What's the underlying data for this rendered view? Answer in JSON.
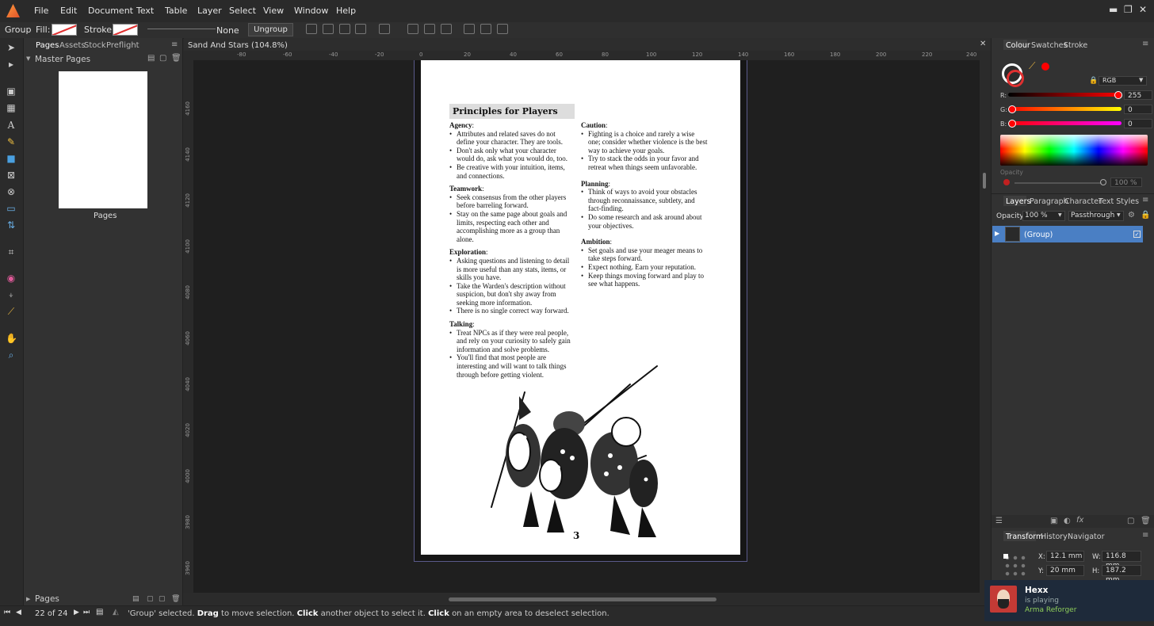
{
  "menubar": {
    "items": [
      "File",
      "Edit",
      "Document",
      "Text",
      "Table",
      "Layer",
      "Select",
      "View",
      "Window",
      "Help"
    ]
  },
  "context_toolbar": {
    "selection_type": "Group",
    "fill_label": "Fill:",
    "stroke_label": "Stroke:",
    "stroke_style": "None",
    "ungroup_label": "Ungroup"
  },
  "pages_panel": {
    "tabs": [
      "Pages",
      "Assets",
      "Stock",
      "Preflight"
    ],
    "master_pages_label": "Master Pages",
    "thumb_label": "Pages",
    "footer_label": "Pages"
  },
  "document": {
    "title": "Sand And Stars (104.8%)",
    "h_ruler": [
      "-80",
      "-60",
      "-40",
      "-20",
      "0",
      "20",
      "40",
      "60",
      "80",
      "100",
      "120",
      "140",
      "160",
      "180",
      "200",
      "220",
      "240"
    ],
    "v_ruler": [
      "4160",
      "4140",
      "4120",
      "4100",
      "4080",
      "4060",
      "4040",
      "4020",
      "4000",
      "3980",
      "3960"
    ]
  },
  "page": {
    "heading": "Principles for Players",
    "left_column": [
      {
        "title": "Agency",
        "items": [
          "Attributes and related saves do not define your character. They are tools.",
          "Don't ask only what your character would do, ask what you would do, too.",
          "Be creative with your intuition, items, and connections."
        ]
      },
      {
        "title": "Teamwork",
        "items": [
          "Seek consensus from the other players before barreling forward.",
          "Stay on the same page about goals and limits, respecting each other and accomplishing more as a group than alone."
        ]
      },
      {
        "title": "Exploration",
        "items": [
          "Asking questions and listening to detail is more useful than any stats, items, or skills you have.",
          "Take the Warden's description without suspicion, but don't shy away from seeking more information.",
          "There is no single correct way forward."
        ]
      },
      {
        "title": "Talking",
        "items": [
          "Treat NPCs as if they were real people, and rely on your curiosity to safely gain information and solve problems.",
          "You'll find that most people are interesting and will want to talk things through before getting violent."
        ]
      }
    ],
    "right_column": [
      {
        "title": "Caution",
        "items": [
          "Fighting is a choice and rarely a wise one; consider whether violence is the best way to achieve your goals.",
          "Try to stack the odds in your favor and retreat when things seem unfavorable."
        ]
      },
      {
        "title": "Planning",
        "items": [
          "Think of ways to avoid your obstacles through reconnaissance, subtlety, and fact-finding.",
          "Do some research and ask around about your objectives."
        ]
      },
      {
        "title": "Ambition",
        "items": [
          "Set goals and use your meager means to take steps forward.",
          "Expect nothing. Earn your reputation.",
          "Keep things moving forward and play to see what happens."
        ]
      }
    ],
    "page_number": "3"
  },
  "colour_panel": {
    "tabs": [
      "Colour",
      "Swatches",
      "Stroke"
    ],
    "model": "RGB",
    "r_label": "R:",
    "r_value": "255",
    "g_label": "G:",
    "g_value": "0",
    "b_label": "B:",
    "b_value": "0",
    "opacity_label": "Opacity",
    "opacity_value": "100 %",
    "accent": "#ff0000"
  },
  "layers_panel": {
    "tabs": [
      "Layers",
      "Paragraph",
      "Character",
      "Text Styles"
    ],
    "opacity_label": "Opacity:",
    "opacity_value": "100 %",
    "blend_mode": "Passthrough",
    "layer_name": "(Group)"
  },
  "transform_panel": {
    "tabs": [
      "Transform",
      "History",
      "Navigator"
    ],
    "x_label": "X:",
    "x_value": "12.1 mm",
    "y_label": "Y:",
    "y_value": "20 mm",
    "w_label": "W:",
    "w_value": "116.8 mm",
    "h_label": "H:",
    "h_value": "187.2 mm"
  },
  "statusbar": {
    "page_counter": "22 of 24",
    "msg_start": "'Group' selected.",
    "msg_drag": "Drag",
    "msg_mid1": "to move selection.",
    "msg_click1": "Click",
    "msg_mid2": "another object to select it.",
    "msg_click2": "Click",
    "msg_end": "on an empty area to deselect selection."
  },
  "notification": {
    "name": "Hexx",
    "status": "is playing",
    "game": "Arma Reforger"
  }
}
